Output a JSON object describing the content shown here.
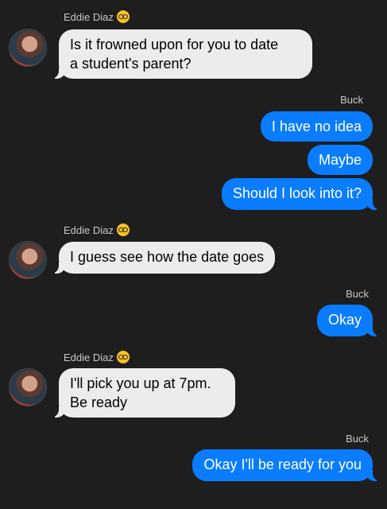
{
  "messages": [
    {
      "sender": "Eddie Diaz",
      "text": "Is it frowned upon for you to date\na student's parent?"
    },
    {
      "sender": "Buck",
      "text": "I have no idea"
    },
    {
      "text": "Maybe"
    },
    {
      "text": "Should I look into it?"
    },
    {
      "sender": "Eddie Diaz",
      "text": "I guess see how the date goes"
    },
    {
      "sender": "Buck",
      "text": "Okay"
    },
    {
      "sender": "Eddie Diaz",
      "text": "I'll pick you up at 7pm.\nBe ready"
    },
    {
      "sender": "Buck",
      "text": "Okay I'll be ready for you"
    }
  ],
  "icons": {
    "sender_emoji": "smiling-face-with-sunglasses-emoji",
    "avatar": "eddie-diaz-avatar"
  },
  "colors": {
    "background": "#1e1e1e",
    "incoming_bubble": "#ececed",
    "outgoing_bubble": "#0a7cff"
  }
}
